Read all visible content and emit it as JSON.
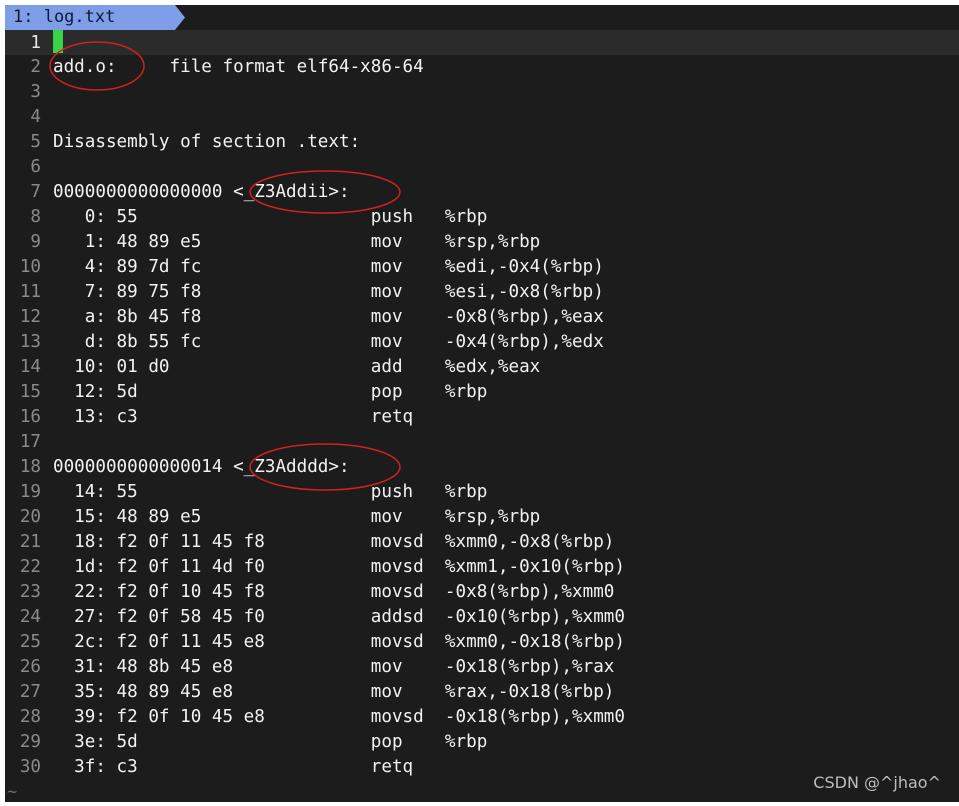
{
  "tab": {
    "label": "1: log.txt"
  },
  "editor": {
    "lines": [
      {
        "num": "1",
        "text": ""
      },
      {
        "num": "2",
        "text": "add.o:     file format elf64-x86-64"
      },
      {
        "num": "3",
        "text": ""
      },
      {
        "num": "4",
        "text": ""
      },
      {
        "num": "5",
        "text": "Disassembly of section .text:"
      },
      {
        "num": "6",
        "text": ""
      },
      {
        "num": "7",
        "text": "0000000000000000 <_Z3Addii>:"
      },
      {
        "num": "8",
        "text": "   0: 55                      push   %rbp"
      },
      {
        "num": "9",
        "text": "   1: 48 89 e5                mov    %rsp,%rbp"
      },
      {
        "num": "10",
        "text": "   4: 89 7d fc                mov    %edi,-0x4(%rbp)"
      },
      {
        "num": "11",
        "text": "   7: 89 75 f8                mov    %esi,-0x8(%rbp)"
      },
      {
        "num": "12",
        "text": "   a: 8b 45 f8                mov    -0x8(%rbp),%eax"
      },
      {
        "num": "13",
        "text": "   d: 8b 55 fc                mov    -0x4(%rbp),%edx"
      },
      {
        "num": "14",
        "text": "  10: 01 d0                   add    %edx,%eax"
      },
      {
        "num": "15",
        "text": "  12: 5d                      pop    %rbp"
      },
      {
        "num": "16",
        "text": "  13: c3                      retq"
      },
      {
        "num": "17",
        "text": ""
      },
      {
        "num": "18",
        "text": "0000000000000014 <_Z3Adddd>:"
      },
      {
        "num": "19",
        "text": "  14: 55                      push   %rbp"
      },
      {
        "num": "20",
        "text": "  15: 48 89 e5                mov    %rsp,%rbp"
      },
      {
        "num": "21",
        "text": "  18: f2 0f 11 45 f8          movsd  %xmm0,-0x8(%rbp)"
      },
      {
        "num": "22",
        "text": "  1d: f2 0f 11 4d f0          movsd  %xmm1,-0x10(%rbp)"
      },
      {
        "num": "23",
        "text": "  22: f2 0f 10 45 f8          movsd  -0x8(%rbp),%xmm0"
      },
      {
        "num": "24",
        "text": "  27: f2 0f 58 45 f0          addsd  -0x10(%rbp),%xmm0"
      },
      {
        "num": "25",
        "text": "  2c: f2 0f 11 45 e8          movsd  %xmm0,-0x18(%rbp)"
      },
      {
        "num": "26",
        "text": "  31: 48 8b 45 e8             mov    -0x18(%rbp),%rax"
      },
      {
        "num": "27",
        "text": "  35: 48 89 45 e8             mov    %rax,-0x18(%rbp)"
      },
      {
        "num": "28",
        "text": "  39: f2 0f 10 45 e8          movsd  -0x18(%rbp),%xmm0"
      },
      {
        "num": "29",
        "text": "  3e: 5d                      pop    %rbp"
      },
      {
        "num": "30",
        "text": "  3f: c3                      retq"
      }
    ],
    "tilde": "~"
  },
  "colors": {
    "background": "#1c1c1c",
    "tab": "#7f9ee8",
    "cursor": "#39d34a",
    "annotation": "#d42020"
  },
  "watermark": "CSDN @^jhao^"
}
